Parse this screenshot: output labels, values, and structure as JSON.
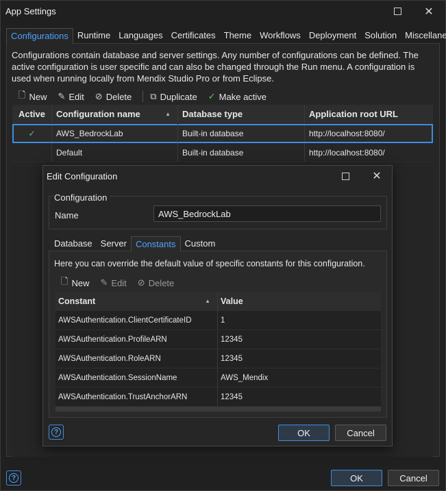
{
  "window": {
    "title": "App Settings"
  },
  "tabs": [
    "Configurations",
    "Runtime",
    "Languages",
    "Certificates",
    "Theme",
    "Workflows",
    "Deployment",
    "Solution",
    "Miscellaneous"
  ],
  "description": "Configurations contain database and server settings. Any number of configurations can be defined. The active configuration is user specific and can also be changed through the Run menu. A configuration is used when running locally from Mendix Studio Pro or from Eclipse.",
  "toolbar": {
    "new": "New",
    "edit": "Edit",
    "delete": "Delete",
    "duplicate": "Duplicate",
    "make_active": "Make active"
  },
  "config_table": {
    "headers": [
      "Active",
      "Configuration name",
      "Database type",
      "Application root URL"
    ],
    "rows": [
      {
        "active": "✓",
        "name": "AWS_BedrockLab",
        "db": "Built-in database",
        "url": "http://localhost:8080/"
      },
      {
        "active": "",
        "name": "Default",
        "db": "Built-in database",
        "url": "http://localhost:8080/"
      }
    ]
  },
  "footer": {
    "ok": "OK",
    "cancel": "Cancel"
  },
  "dialog": {
    "title": "Edit Configuration",
    "group_label": "Configuration",
    "name_label": "Name",
    "name_value": "AWS_BedrockLab",
    "tabs": [
      "Database",
      "Server",
      "Constants",
      "Custom"
    ],
    "description": "Here you can override the default value of specific constants for this configuration.",
    "toolbar": {
      "new": "New",
      "edit": "Edit",
      "delete": "Delete"
    },
    "constants": {
      "headers": [
        "Constant",
        "Value"
      ],
      "rows": [
        {
          "constant": "AWSAuthentication.ClientCertificateID",
          "value": "1"
        },
        {
          "constant": "AWSAuthentication.ProfileARN",
          "value": "12345"
        },
        {
          "constant": "AWSAuthentication.RoleARN",
          "value": "12345"
        },
        {
          "constant": "AWSAuthentication.SessionName",
          "value": "AWS_Mendix"
        },
        {
          "constant": "AWSAuthentication.TrustAnchorARN",
          "value": "12345"
        }
      ]
    },
    "ok": "OK",
    "cancel": "Cancel"
  },
  "colors": {
    "accent": "#3d8ee0",
    "active_check": "#5cc55c",
    "background": "#202020"
  }
}
